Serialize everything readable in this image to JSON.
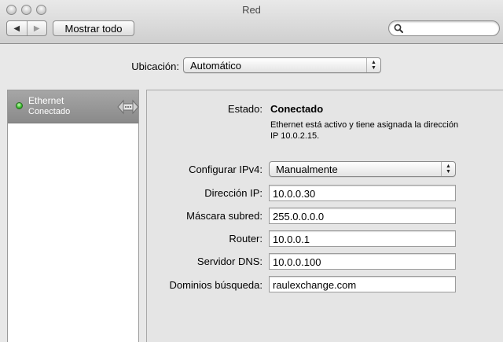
{
  "window": {
    "title": "Red"
  },
  "toolbar": {
    "back_glyph": "◀",
    "forward_glyph": "▶",
    "show_all_label": "Mostrar todo",
    "search_value": ""
  },
  "location": {
    "label": "Ubicación:",
    "value": "Automático"
  },
  "services": [
    {
      "name": "Ethernet",
      "status": "Conectado",
      "status_color": "#35b82a",
      "icon": "ethernet-icon"
    }
  ],
  "detail": {
    "status_label": "Estado:",
    "status_value": "Conectado",
    "status_description": "Ethernet está activo y tiene asignada la dirección IP 10.0.2.15.",
    "ipv4": {
      "label": "Configurar IPv4:",
      "value": "Manualmente"
    },
    "fields": {
      "ip": {
        "label": "Dirección IP:",
        "value": "10.0.0.30"
      },
      "mask": {
        "label": "Máscara subred:",
        "value": "255.0.0.0.0"
      },
      "router": {
        "label": "Router:",
        "value": "10.0.0.1"
      },
      "dns": {
        "label": "Servidor DNS:",
        "value": "10.0.0.100"
      },
      "domains": {
        "label": "Dominios búsqueda:",
        "value": "raulexchange.com"
      }
    }
  }
}
